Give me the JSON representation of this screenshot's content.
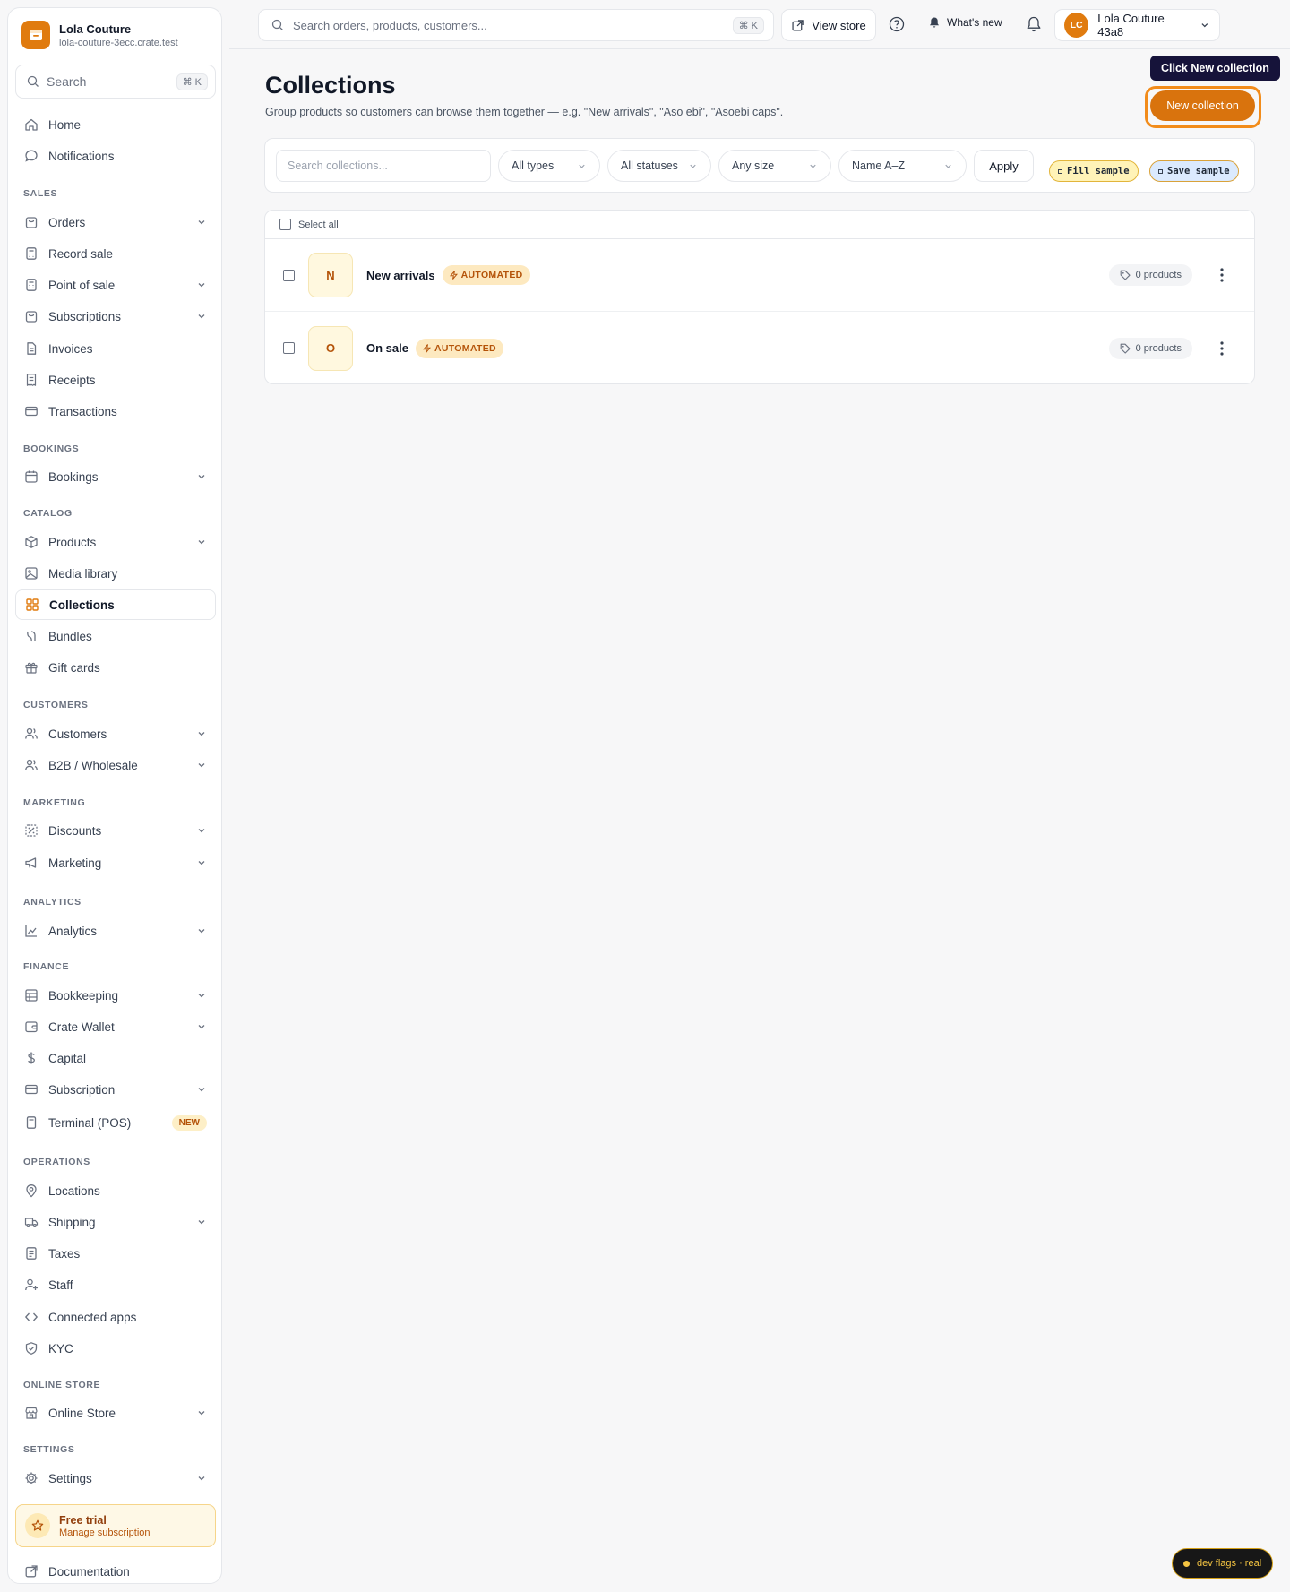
{
  "store": {
    "name": "Lola Couture",
    "domain": "lola-couture-3ecc.crate.test"
  },
  "sidebar": {
    "search_placeholder": "Search",
    "search_kbd": "⌘ K",
    "top_items": [
      "Home",
      "Notifications"
    ],
    "sections": {
      "sales": "SALES",
      "bookings": "BOOKINGS",
      "catalog": "CATALOG",
      "customers": "CUSTOMERS",
      "marketing": "MARKETING",
      "analytics": "ANALYTICS",
      "finance": "FINANCE",
      "operations": "OPERATIONS",
      "online_store": "ONLINE STORE",
      "settings": "SETTINGS"
    },
    "items": {
      "orders": "Orders",
      "record_sale": "Record sale",
      "point_of_sale": "Point of sale",
      "subscriptions": "Subscriptions",
      "invoices": "Invoices",
      "receipts": "Receipts",
      "transactions": "Transactions",
      "bookings": "Bookings",
      "products": "Products",
      "media_library": "Media library",
      "collections": "Collections",
      "bundles": "Bundles",
      "gift_cards": "Gift cards",
      "customers": "Customers",
      "b2b": "B2B / Wholesale",
      "discounts": "Discounts",
      "marketing": "Marketing",
      "analytics": "Analytics",
      "bookkeeping": "Bookkeeping",
      "crate_wallet": "Crate Wallet",
      "capital": "Capital",
      "subscription": "Subscription",
      "terminal": "Terminal (POS)",
      "locations": "Locations",
      "shipping": "Shipping",
      "taxes": "Taxes",
      "staff": "Staff",
      "connected_apps": "Connected apps",
      "kyc": "KYC",
      "online_store": "Online Store",
      "settings": "Settings"
    },
    "terminal_badge": "NEW",
    "trial": {
      "title": "Free trial",
      "subtitle": "Manage subscription"
    },
    "documentation": "Documentation"
  },
  "topbar": {
    "search_placeholder": "Search orders, products, customers...",
    "search_kbd": "⌘ K",
    "view_store": "View store",
    "whats_new": "What's new",
    "avatar_initials": "LC",
    "account_name": "Lola Couture 43a8"
  },
  "main": {
    "title": "Collections",
    "subtitle": "Group products so customers can browse them together — e.g. \"New arrivals\", \"Aso ebi\", \"Asoebi caps\".",
    "tooltip": "Click New collection",
    "new_button": "New collection",
    "filters": {
      "search_placeholder": "Search collections...",
      "type": "All types",
      "status": "All statuses",
      "size": "Any size",
      "sort": "Name A–Z",
      "apply": "Apply",
      "fill_sample": "Fill sample",
      "save_sample": "Save sample"
    },
    "select_all": "Select all",
    "collections": [
      {
        "initial": "N",
        "name": "New arrivals",
        "badge": "AUTOMATED",
        "count": "0 products"
      },
      {
        "initial": "O",
        "name": "On sale",
        "badge": "AUTOMATED",
        "count": "0 products"
      }
    ]
  },
  "dev_flags": "dev flags · real",
  "colors": {
    "accent": "#d9730d",
    "brand_logo": "#e07b0f"
  }
}
